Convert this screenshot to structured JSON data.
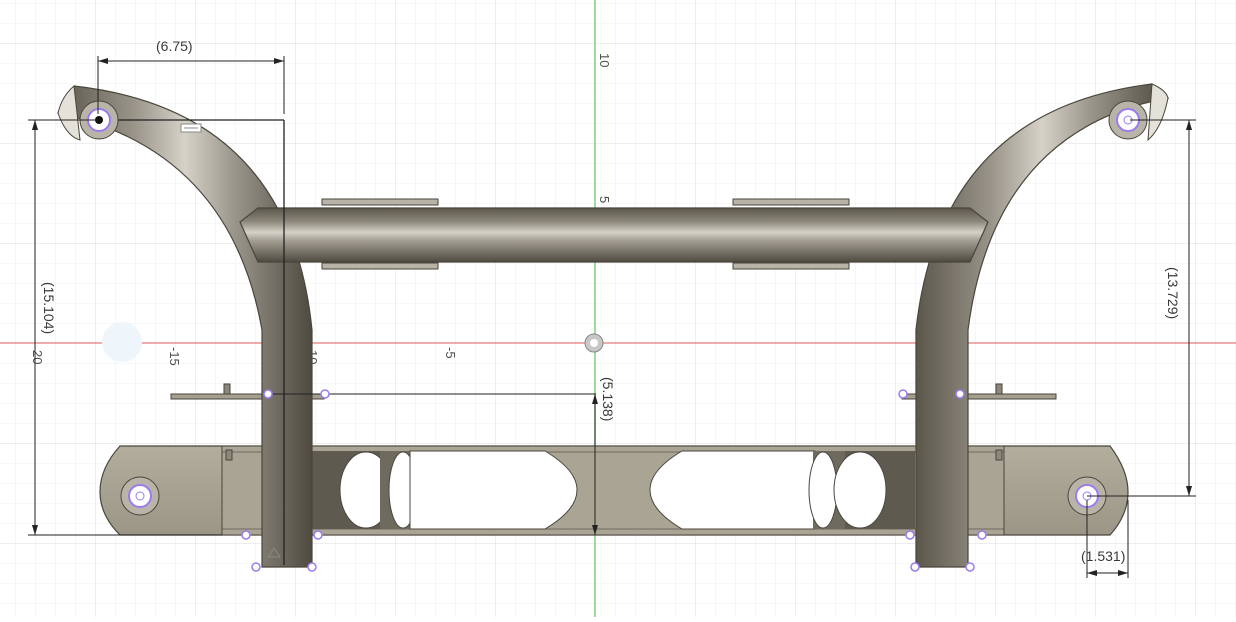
{
  "colors": {
    "background": "#ffffff",
    "grid_minor": "#efefef",
    "grid_major": "#dcdcdc",
    "x_axis": "#e05a5a",
    "y_axis": "#7ed07e",
    "tube_dark": "#5a5548",
    "tube_light": "#cfcbc0",
    "plate": "#a59f90",
    "plate_dark": "#6f6a5e",
    "point": "#9a7cf0",
    "dimension_line": "#222222"
  },
  "axis_labels": {
    "y_10": "10",
    "y_5": "5",
    "x_minus_5": "-5",
    "x_minus_10": "10",
    "x_minus_15": "-15",
    "x_minus_20": "20"
  },
  "dimensions": {
    "top_width": "(6.75)",
    "left_height": "(15.104)",
    "right_height": "(13.729)",
    "center_height": "(5.138)",
    "bottom_right_width": "(1.531)"
  },
  "icons": {
    "origin": "origin-icon",
    "sketch_constraint": "constraint-icon",
    "triangle_marker": "triangle-marker-icon"
  }
}
